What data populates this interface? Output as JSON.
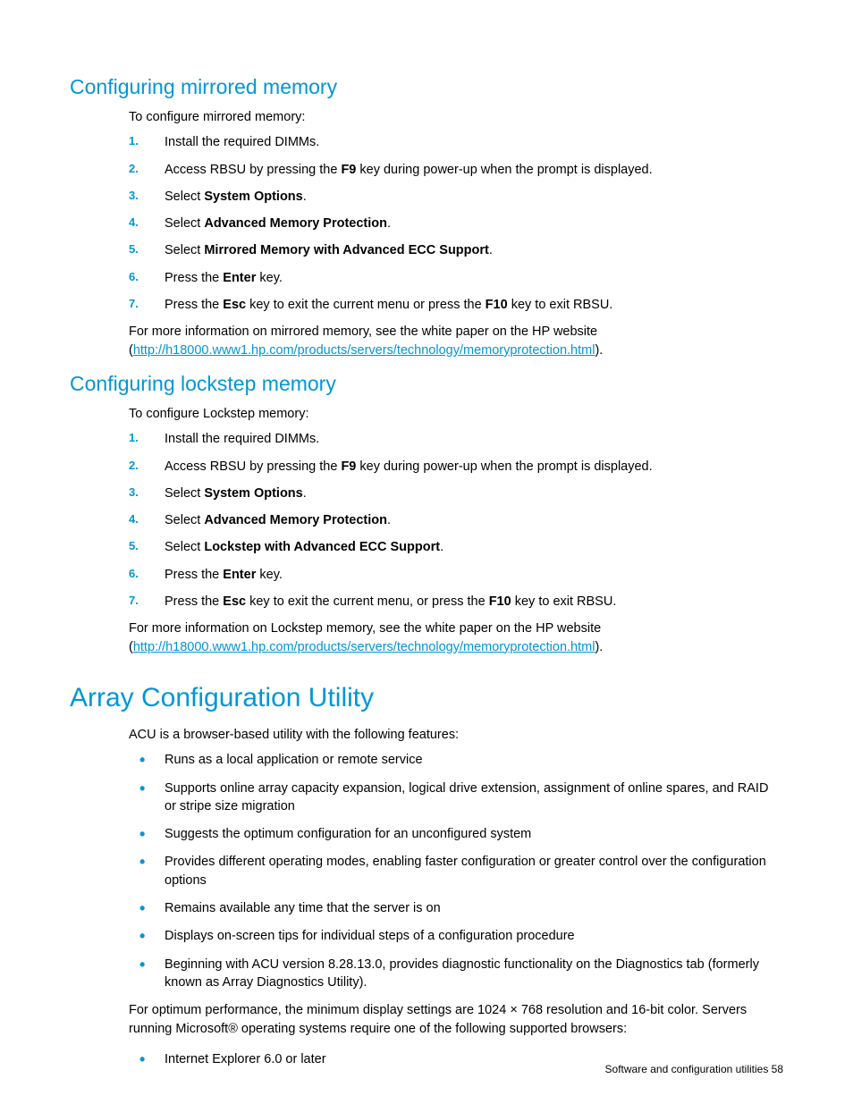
{
  "mirrored": {
    "heading": "Configuring mirrored memory",
    "intro": "To configure mirrored memory:",
    "step1": "Install the required DIMMs.",
    "step2a": "Access RBSU by pressing the ",
    "step2b": "F9",
    "step2c": " key during power-up when the prompt is displayed.",
    "step3a": "Select ",
    "step3b": "System Options",
    "step3c": ".",
    "step4a": "Select ",
    "step4b": "Advanced Memory Protection",
    "step4c": ".",
    "step5a": "Select ",
    "step5b": "Mirrored Memory with Advanced ECC Support",
    "step5c": ".",
    "step6a": "Press the ",
    "step6b": "Enter",
    "step6c": " key.",
    "step7a": "Press the ",
    "step7b": "Esc",
    "step7c": " key to exit the current menu or press the ",
    "step7d": "F10",
    "step7e": " key to exit RBSU.",
    "footnote1": "For more information on mirrored memory, see the white paper on the HP website (",
    "footlink": "http://h18000.www1.hp.com/products/servers/technology/memoryprotection.html",
    "footnote2": ")."
  },
  "lockstep": {
    "heading": "Configuring lockstep memory",
    "intro": "To configure Lockstep memory:",
    "step1": "Install the required DIMMs.",
    "step2a": "Access RBSU by pressing the ",
    "step2b": "F9",
    "step2c": " key during power-up when the prompt is displayed.",
    "step3a": "Select ",
    "step3b": "System Options",
    "step3c": ".",
    "step4a": "Select ",
    "step4b": "Advanced Memory Protection",
    "step4c": ".",
    "step5a": "Select ",
    "step5b": "Lockstep with Advanced ECC Support",
    "step5c": ".",
    "step6a": "Press the ",
    "step6b": "Enter",
    "step6c": " key.",
    "step7a": "Press the ",
    "step7b": "Esc",
    "step7c": " key to exit the current menu, or press the ",
    "step7d": "F10",
    "step7e": " key to exit RBSU.",
    "footnote1": "For more information on Lockstep memory, see the white paper on the HP website (",
    "footlink": "http://h18000.www1.hp.com/products/servers/technology/memoryprotection.html",
    "footnote2": ")."
  },
  "acu": {
    "heading": "Array Configuration Utility",
    "intro": "ACU is a browser-based utility with the following features:",
    "b1": "Runs as a local application or remote service",
    "b2": "Supports online array capacity expansion, logical drive extension, assignment of online spares, and RAID or stripe size migration",
    "b3": "Suggests the optimum configuration for an unconfigured system",
    "b4": "Provides different operating modes, enabling faster configuration or greater control over the configuration options",
    "b5": "Remains available any time that the server is on",
    "b6": "Displays on-screen tips for individual steps of a configuration procedure",
    "b7": "Beginning with ACU version 8.28.13.0, provides diagnostic functionality on the Diagnostics tab (formerly known as Array Diagnostics Utility).",
    "para": "For optimum performance, the minimum display settings are 1024 × 768 resolution and 16-bit color. Servers running Microsoft® operating systems require one of the following supported browsers:",
    "b8": "Internet Explorer 6.0 or later"
  },
  "footer": {
    "text": "Software and configuration utilities   58"
  }
}
